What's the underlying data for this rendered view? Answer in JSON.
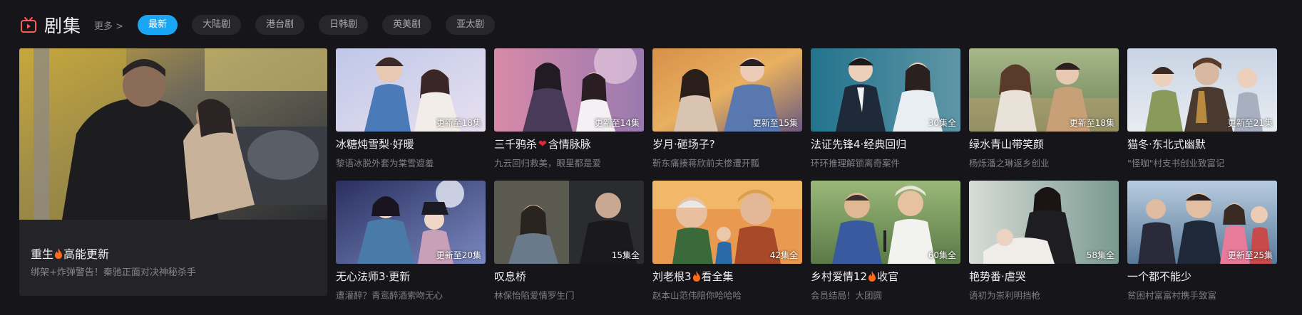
{
  "header": {
    "title": "剧集",
    "more": "更多 >",
    "tabs": [
      {
        "label": "最新",
        "active": true
      },
      {
        "label": "大陆剧",
        "active": false
      },
      {
        "label": "港台剧",
        "active": false
      },
      {
        "label": "日韩剧",
        "active": false
      },
      {
        "label": "英美剧",
        "active": false
      },
      {
        "label": "亚太剧",
        "active": false
      }
    ]
  },
  "feature": {
    "title_a": "重生",
    "title_b": "高能更新",
    "desc": "绑架+炸弹警告！秦驰正面对决神秘杀手"
  },
  "row1": [
    {
      "title": "冰糖炖雪梨·好暖",
      "desc": "黎语冰脱外套为棠雪遮羞",
      "badge": "更新至18集"
    },
    {
      "title_a": "三千鸦杀",
      "title_b": "含情脉脉",
      "desc": "九云回归救美，眼里都是爱",
      "badge": "更新至14集"
    },
    {
      "title": "岁月·砸场子?",
      "desc": "靳东痛揍蒋欣前夫惨遭开瓢",
      "badge": "更新至15集"
    },
    {
      "title": "法证先锋4·经典回归",
      "desc": "环环推理解锁离奇案件",
      "badge": "30集全"
    },
    {
      "title": "绿水青山带笑颜",
      "desc": "杨烁潘之琳返乡创业",
      "badge": "更新至18集"
    },
    {
      "title": "猫冬·东北式幽默",
      "desc": "\"怪咖\"村支书创业致富记",
      "badge": "更新至21集"
    }
  ],
  "row2": [
    {
      "title": "无心法师3·更新",
      "desc": "遭灌醉？青鸾醉酒索吻无心",
      "badge": "更新至20集"
    },
    {
      "title": "叹息桥",
      "desc": "林保怡陷爱情罗生门",
      "badge": "15集全"
    },
    {
      "title_a": "刘老根3",
      "title_b": "看全集",
      "desc": "赵本山范伟陪你哈哈哈",
      "badge": "42集全"
    },
    {
      "title_a": "乡村爱情12",
      "title_b": "收官",
      "desc": "会员结局！大团圆",
      "badge": "60集全"
    },
    {
      "title": "艳势番·虐哭",
      "desc": "语初为崇利明挡枪",
      "badge": "58集全"
    },
    {
      "title": "一个都不能少",
      "desc": "贫困村富富村携手致富",
      "badge": "更新至25集"
    }
  ],
  "colors": {
    "accent": "#18a6f5",
    "background": "#16161a",
    "fire": "#ff6a1a",
    "heart": "#e0283a",
    "logo": "#ff5a5a"
  }
}
